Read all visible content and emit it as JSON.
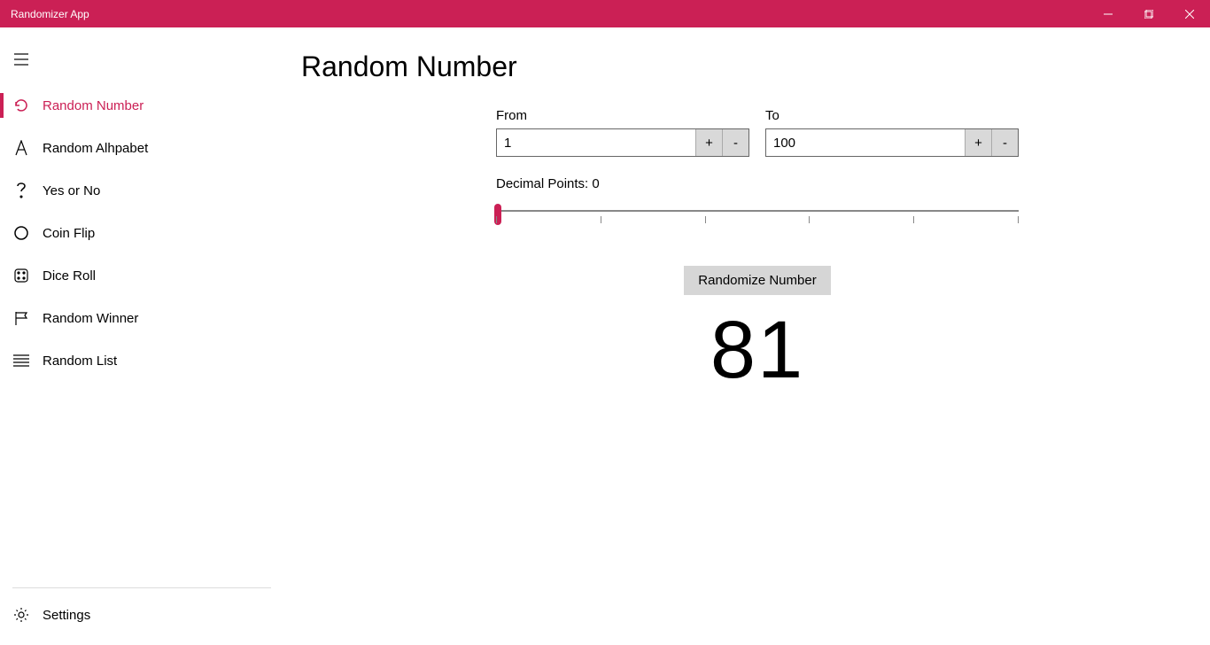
{
  "window": {
    "title": "Randomizer App"
  },
  "sidebar": {
    "items": [
      {
        "label": "Random Number",
        "active": true,
        "icon": "refresh-icon"
      },
      {
        "label": "Random Alhpabet",
        "active": false,
        "icon": "alphabet-icon"
      },
      {
        "label": "Yes or No",
        "active": false,
        "icon": "question-icon"
      },
      {
        "label": "Coin Flip",
        "active": false,
        "icon": "circle-icon"
      },
      {
        "label": "Dice Roll",
        "active": false,
        "icon": "dice-icon"
      },
      {
        "label": "Random Winner",
        "active": false,
        "icon": "flag-icon"
      },
      {
        "label": "Random List",
        "active": false,
        "icon": "list-icon"
      }
    ],
    "settings_label": "Settings"
  },
  "page": {
    "title": "Random Number",
    "from_label": "From",
    "to_label": "To",
    "from_value": "1",
    "to_value": "100",
    "decimal_label": "Decimal Points: 0",
    "randomize_label": "Randomize Number",
    "result": "81"
  },
  "colors": {
    "accent": "#cb2055"
  }
}
